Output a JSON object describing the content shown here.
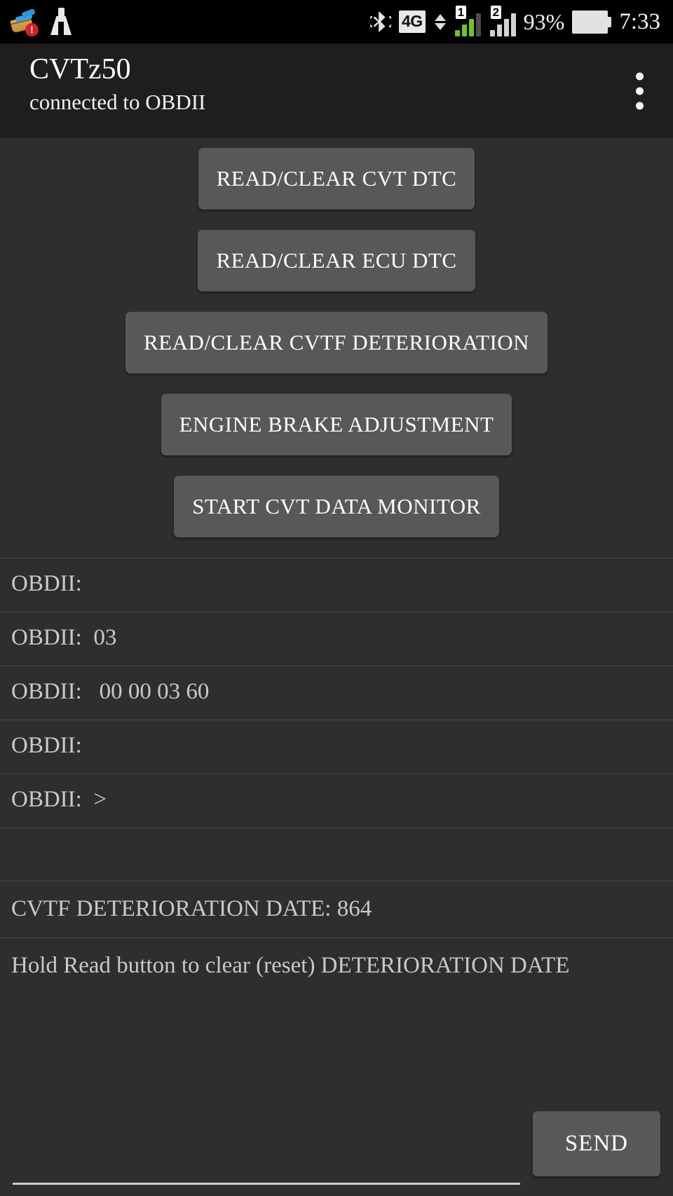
{
  "status_bar": {
    "left_icons": [
      "cleaner-alert-icon",
      "broom-icon"
    ],
    "bluetooth_icon": "bluetooth-icon",
    "network_badge": "4G",
    "sim1_label": "1",
    "sim2_label": "2",
    "battery_percent": "93%",
    "time": "7:33"
  },
  "app_bar": {
    "title": "CVTz50",
    "subtitle": "connected to OBDII",
    "overflow_icon": "more-vertical-icon"
  },
  "actions": [
    {
      "label": "READ/CLEAR CVT DTC",
      "name": "read-clear-cvt-dtc-button"
    },
    {
      "label": "READ/CLEAR ECU DTC",
      "name": "read-clear-ecu-dtc-button"
    },
    {
      "label": "READ/CLEAR CVTF DETERIORATION",
      "name": "read-clear-cvtf-deterioration-button"
    },
    {
      "label": "ENGINE BRAKE ADJUSTMENT",
      "name": "engine-brake-adjustment-button"
    },
    {
      "label": "START CVT DATA MONITOR",
      "name": "start-cvt-data-monitor-button"
    }
  ],
  "log": {
    "rows": [
      "OBDII:",
      "OBDII:  03",
      "OBDII:   00 00 03 60",
      "OBDII:",
      "OBDII:  >",
      ""
    ]
  },
  "notes": {
    "deterioration": "CVTF DETERIORATION DATE: 864",
    "hint": "Hold Read button to clear (reset) DETERIORATION DATE"
  },
  "input": {
    "value": "",
    "placeholder": "",
    "send_label": "SEND"
  },
  "colors": {
    "background": "#2e2e2e",
    "appbar": "#1e1e1e",
    "button": "#585858",
    "text": "#c9c9c9",
    "divider": "#4a4a4a",
    "signal_active": "#6fc12a"
  }
}
